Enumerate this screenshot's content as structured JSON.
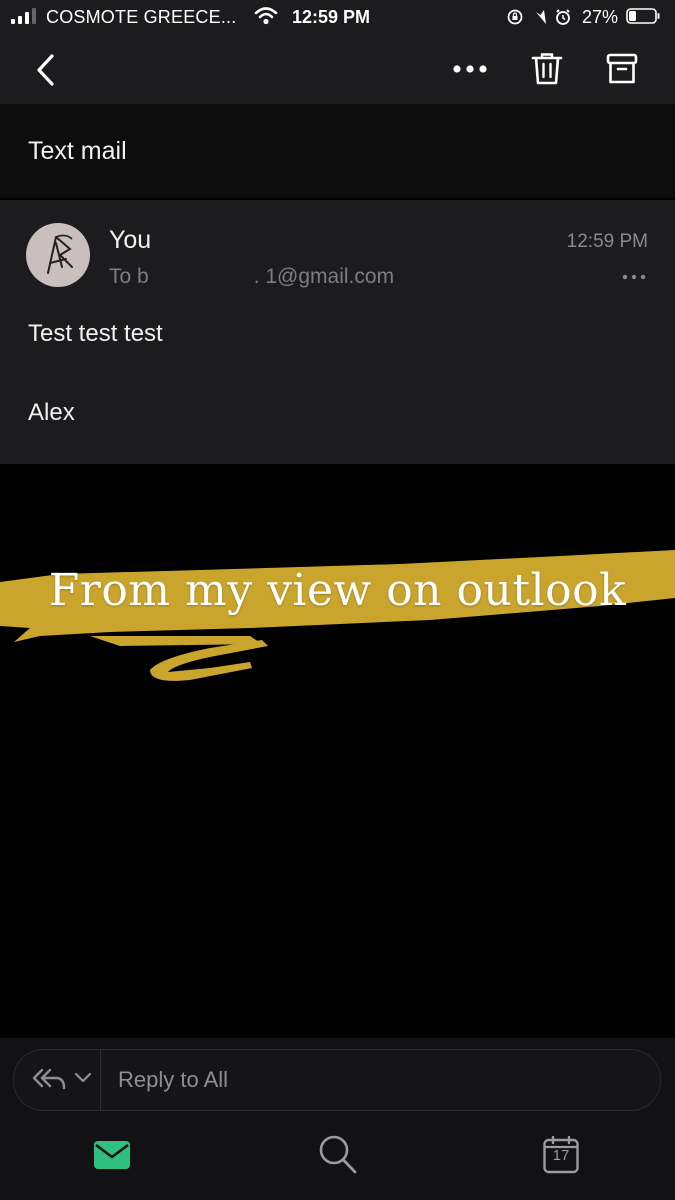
{
  "status_bar": {
    "carrier": "COSMOTE GREECE...",
    "time": "12:59 PM",
    "battery": "27%"
  },
  "toolbar": {
    "icons": [
      "back-icon",
      "more-icon",
      "trash-icon",
      "archive-icon"
    ]
  },
  "email": {
    "subject": "Text mail",
    "sender": "You",
    "recipient": "To b                  . 1@gmail.com",
    "time": "12:59 PM",
    "body_line1": "Test test test",
    "body_line2": "Alex"
  },
  "overlay": {
    "text": "From my view on outlook",
    "brush_color": "#caa52e"
  },
  "reply": {
    "placeholder": "Reply to All"
  },
  "tab_bar": {
    "calendar_day": "17",
    "accent": "#2fbf7f"
  }
}
